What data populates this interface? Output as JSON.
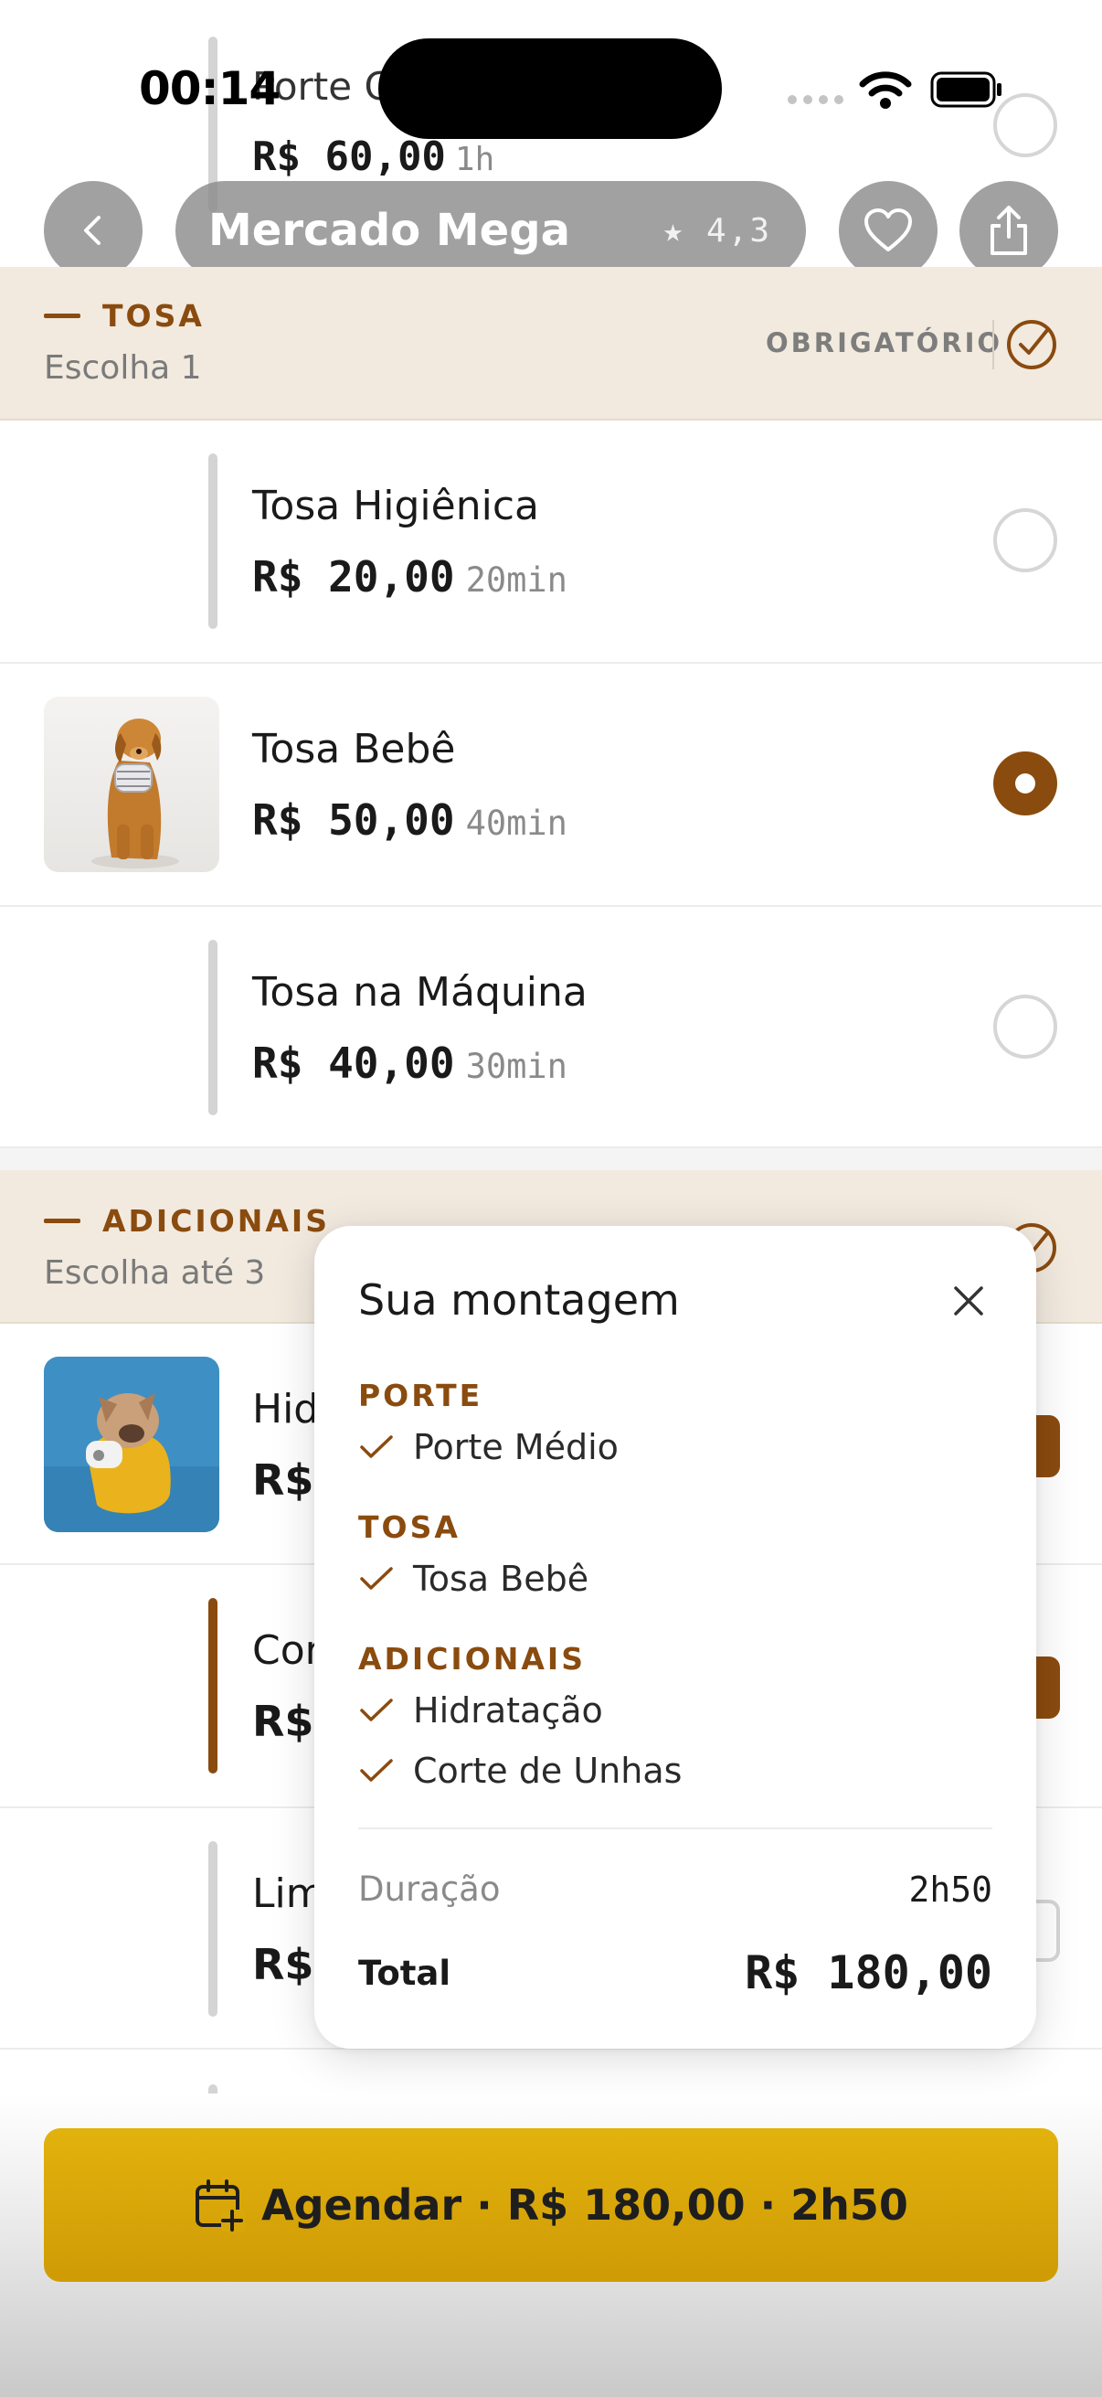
{
  "status_bar": {
    "time": "00:14"
  },
  "prev_item": {
    "name": "Porte G",
    "price": "R$ 60,00",
    "duration": "1h"
  },
  "header": {
    "store_name": "Mercado Mega",
    "rating": "★ 4,3"
  },
  "tosa_section": {
    "title": "TOSA",
    "subtitle": "Escolha 1",
    "required_label": "OBRIGATÓRIO",
    "options": [
      {
        "name": "Tosa Higiênica",
        "price": "R$ 20,00",
        "duration": "20min",
        "selected": false
      },
      {
        "name": "Tosa Bebê",
        "price": "R$ 50,00",
        "duration": "40min",
        "selected": true
      },
      {
        "name": "Tosa na Máquina",
        "price": "R$ 40,00",
        "duration": "30min",
        "selected": false
      }
    ]
  },
  "adicionais_section": {
    "title": "ADICIONAIS",
    "subtitle": "Escolha até 3",
    "options": [
      {
        "name_visible": "Hid",
        "price_visible": "R$",
        "selected": true
      },
      {
        "name_visible": "Cor",
        "price_visible": "R$",
        "selected": true
      },
      {
        "name_visible": "Lim",
        "price_visible": "R$",
        "selected": false
      }
    ]
  },
  "summary": {
    "title": "Sua montagem",
    "groups": [
      {
        "label": "PORTE",
        "items": [
          "Porte Médio"
        ]
      },
      {
        "label": "TOSA",
        "items": [
          "Tosa Bebê"
        ]
      },
      {
        "label": "ADICIONAIS",
        "items": [
          "Hidratação",
          "Corte de Unhas"
        ]
      }
    ],
    "duration_label": "Duração",
    "duration_value": "2h50",
    "total_label": "Total",
    "total_value": "R$ 180,00"
  },
  "cta": {
    "label": "Agendar · R$ 180,00 · 2h50"
  },
  "colors": {
    "brand": "#8a4b0f",
    "section_bg": "#f2eadf",
    "cta": "#dba709"
  }
}
